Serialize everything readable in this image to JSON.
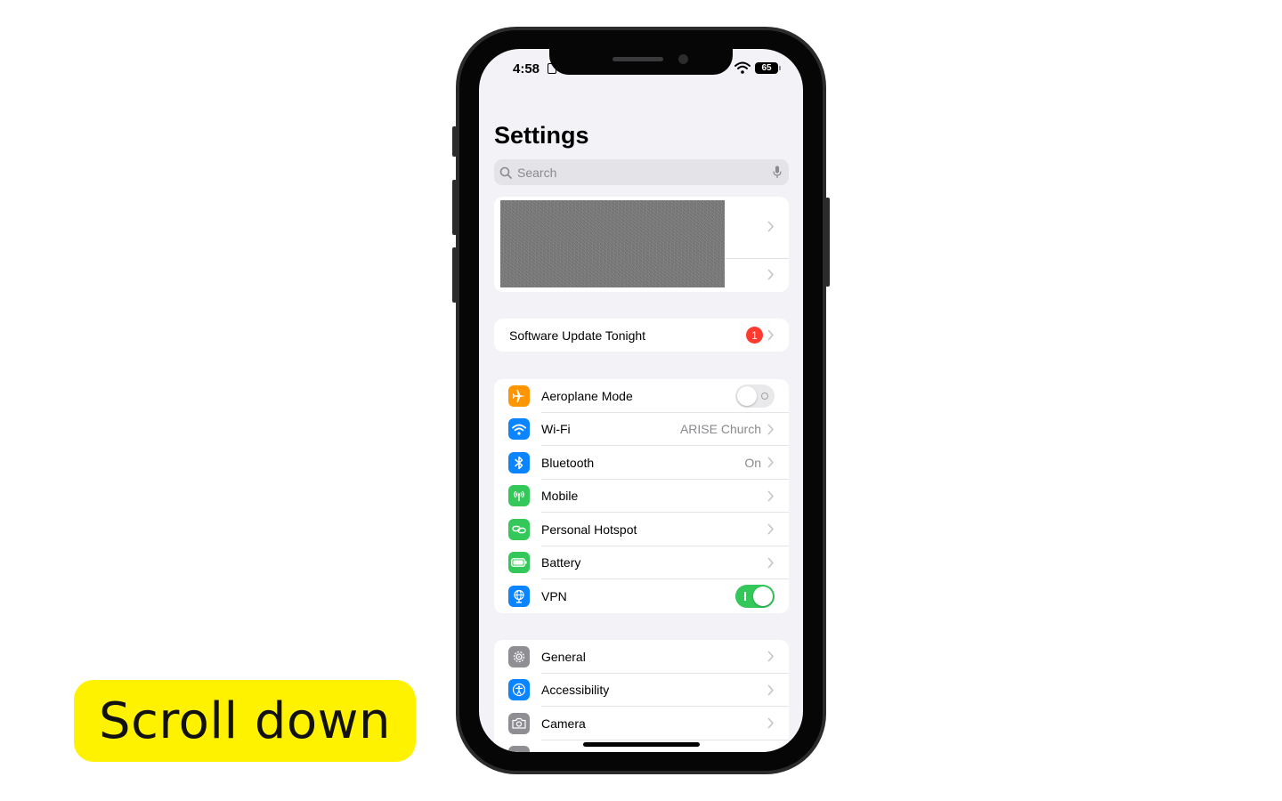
{
  "caption": {
    "text": "Scroll down"
  },
  "status_bar": {
    "time": "4:58",
    "battery": "65"
  },
  "header": {
    "title": "Settings"
  },
  "search": {
    "placeholder": "Search"
  },
  "update": {
    "label": "Software Update Tonight",
    "badge": "1"
  },
  "network": {
    "items": [
      {
        "label": "Aeroplane Mode",
        "value": "",
        "toggle": "off",
        "icon": "airplane-icon",
        "color": "#ff9500"
      },
      {
        "label": "Wi-Fi",
        "value": "ARISE Church",
        "icon": "wifi-icon",
        "color": "#0a84ff"
      },
      {
        "label": "Bluetooth",
        "value": "On",
        "icon": "bluetooth-icon",
        "color": "#0a84ff"
      },
      {
        "label": "Mobile",
        "value": "",
        "icon": "antenna-icon",
        "color": "#34c759"
      },
      {
        "label": "Personal Hotspot",
        "value": "",
        "icon": "link-icon",
        "color": "#34c759"
      },
      {
        "label": "Battery",
        "value": "",
        "icon": "battery-icon",
        "color": "#34c759"
      },
      {
        "label": "VPN",
        "value": "",
        "toggle": "on",
        "icon": "globe-icon",
        "color": "#0a84ff"
      }
    ]
  },
  "general": {
    "items": [
      {
        "label": "General",
        "icon": "gear-icon",
        "color": "#8e8e93"
      },
      {
        "label": "Accessibility",
        "icon": "accessibility-icon",
        "color": "#0a84ff"
      },
      {
        "label": "Camera",
        "icon": "camera-icon",
        "color": "#8e8e93"
      }
    ]
  }
}
